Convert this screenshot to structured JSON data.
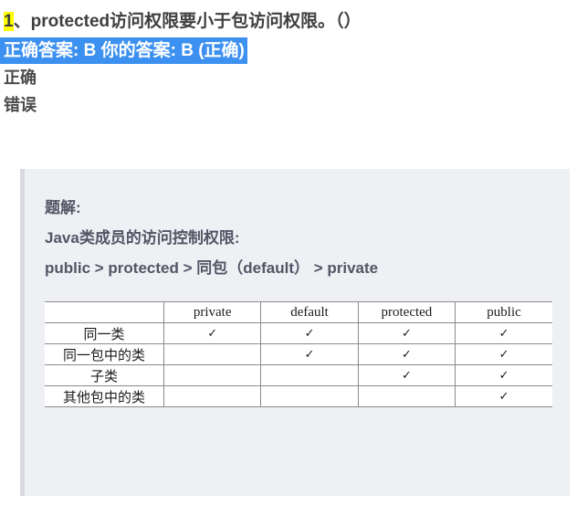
{
  "question": {
    "number": "1",
    "separator": "、",
    "text": "protected访问权限要小于包访问权限。（）",
    "highlight_color": "#ffff00"
  },
  "answer_bar": {
    "text": "正确答案: B 你的答案: B (正确)",
    "background_color": "#3c90f0",
    "text_color": "#ffffff"
  },
  "options": [
    {
      "label": "正确"
    },
    {
      "label": "错误"
    }
  ],
  "explanation": {
    "heading": "题解:",
    "subheading": "Java类成员的访问控制权限:",
    "formula": "public > protected > 同包（default） > private",
    "panel_background": "#eef0f4",
    "accent_color": "#d8d8e2"
  },
  "permission_table": {
    "columns": [
      "",
      "private",
      "default",
      "protected",
      "public"
    ],
    "rows": [
      {
        "label": "同一类",
        "cells": [
          "✓",
          "✓",
          "✓",
          "✓"
        ]
      },
      {
        "label": "同一包中的类",
        "cells": [
          "",
          "✓",
          "✓",
          "✓"
        ]
      },
      {
        "label": "子类",
        "cells": [
          "",
          "",
          "✓",
          "✓"
        ]
      },
      {
        "label": "其他包中的类",
        "cells": [
          "",
          "",
          "",
          "✓"
        ]
      }
    ]
  }
}
